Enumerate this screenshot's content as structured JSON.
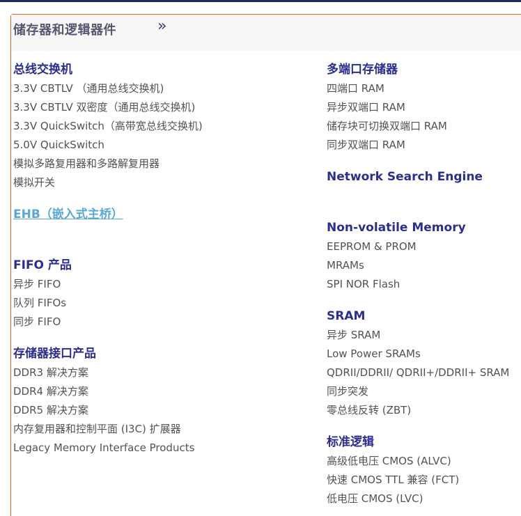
{
  "header": {
    "title": "储存器和逻辑器件",
    "chevron_icon": "double-chevron-right-icon"
  },
  "left_column": [
    {
      "title": "总线交换机",
      "items": [
        "3.3V CBTLV （通用总线交换机)",
        "3.3V CBTLV 双密度（通用总线交换机)",
        "3.3V QuickSwitch（高带宽总线交换机)",
        "5.0V QuickSwitch",
        "模拟多路复用器和多路解复用器",
        "模拟开关"
      ]
    },
    {
      "title": "EHB（嵌入式主桥）",
      "items": []
    },
    {
      "title": "FIFO 产品",
      "items": [
        "异步 FIFO",
        "队列 FIFOs",
        "同步 FIFO"
      ]
    },
    {
      "title": "存储器接口产品",
      "items": [
        "DDR3 解决方案",
        "DDR4 解决方案",
        "DDR5 解决方案",
        "内存复用器和控制平面 (I3C) 扩展器",
        "Legacy Memory Interface Products"
      ]
    }
  ],
  "right_column": [
    {
      "title": "多端口存储器",
      "items": [
        "四端口 RAM",
        "异步双端口 RAM",
        "储存块可切换双端口 RAM",
        "同步双端口 RAM"
      ]
    },
    {
      "title": "Network Search Engine",
      "items": []
    },
    {
      "title": "Non-volatile Memory",
      "items": [
        "EEPROM & PROM",
        "MRAMs",
        "SPI NOR Flash"
      ]
    },
    {
      "title": "SRAM",
      "items": [
        "异步 SRAM",
        "Low Power SRAMs",
        "QDRII/DDRII/ QDRII+/DDRII+ SRAM",
        "同步突发",
        "零总线反转 (ZBT)"
      ]
    },
    {
      "title": "标准逻辑",
      "items": [
        "高级低电压 CMOS (ALVC)",
        "快速 CMOS TTL 兼容 (FCT)",
        "低电压 CMOS (LVC)"
      ]
    }
  ],
  "colors": {
    "title": "#2b2e8c",
    "link": "#5aa9d0",
    "item": "#505256",
    "border": "#d2691e"
  }
}
